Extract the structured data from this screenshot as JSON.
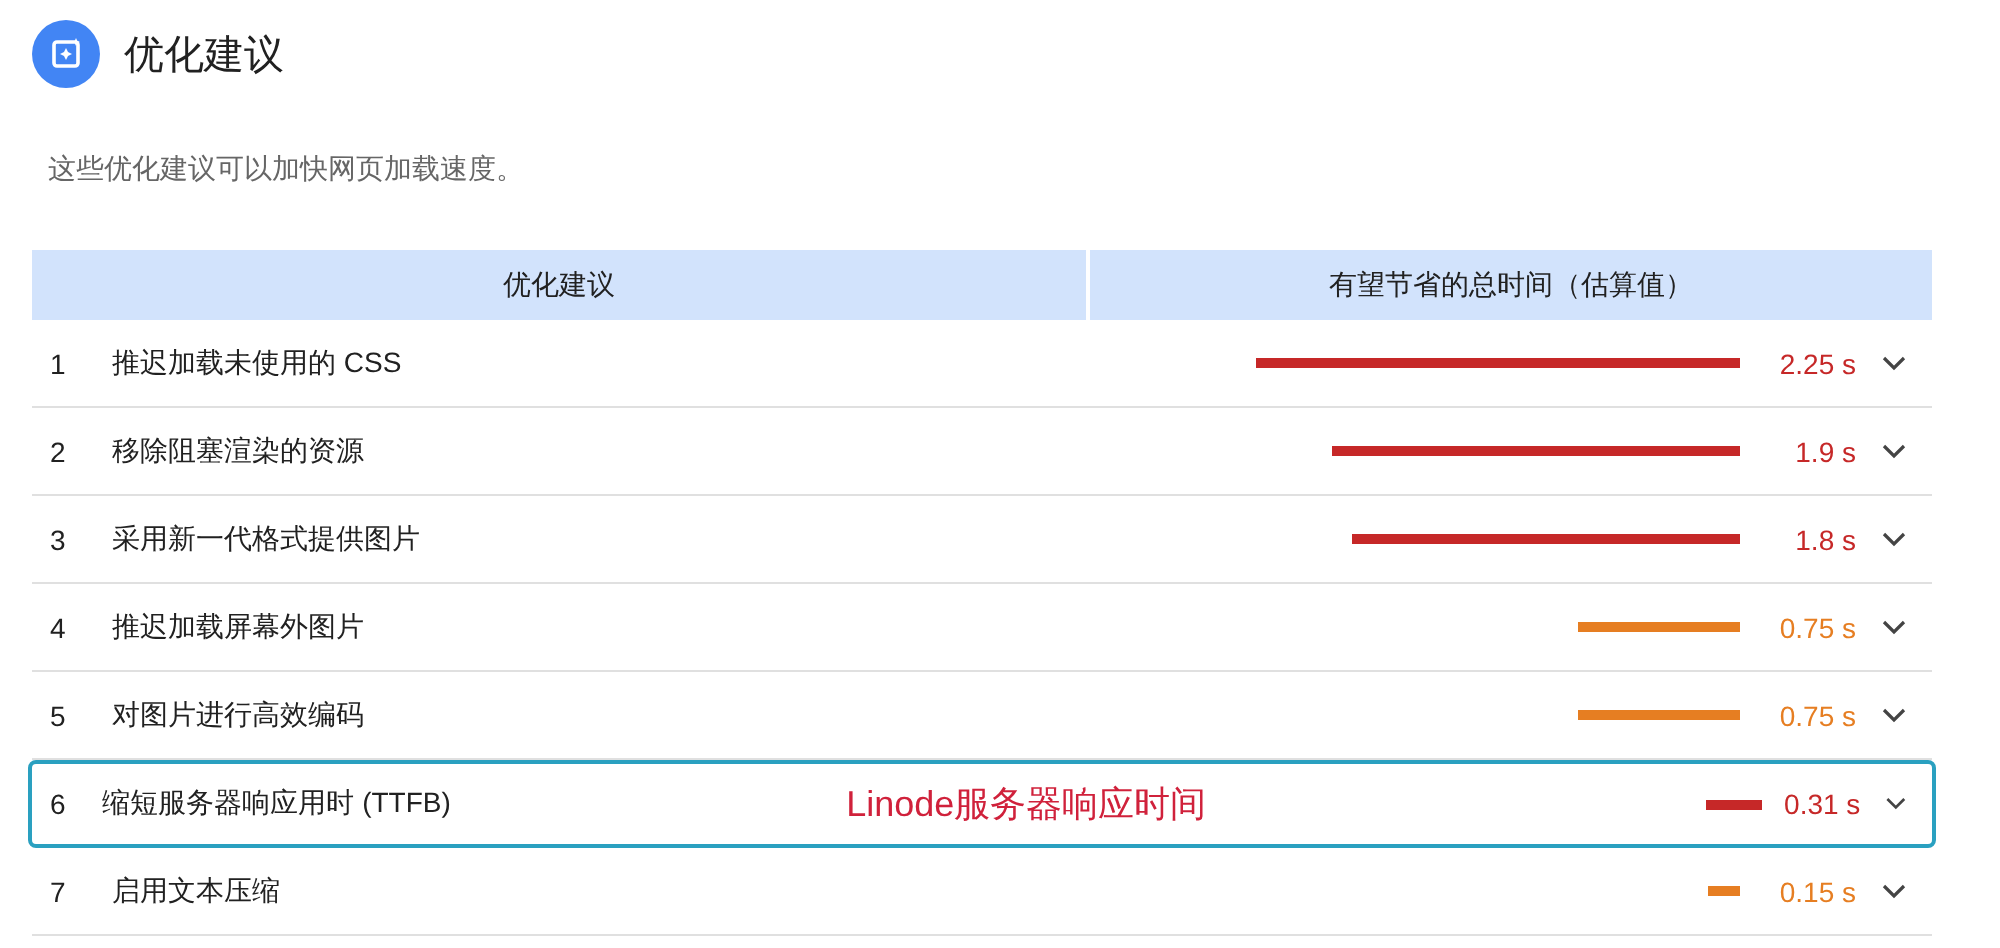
{
  "section": {
    "title": "优化建议",
    "description": "这些优化建议可以加快网页加载速度。"
  },
  "table": {
    "columns": [
      "优化建议",
      "有望节省的总时间（估算值）"
    ],
    "rows": [
      {
        "index": "1",
        "name": "推迟加载未使用的 CSS",
        "color": "#c62828",
        "savings": "2.25 s",
        "expanded": false,
        "highlighted": false
      },
      {
        "index": "2",
        "name": "移除阻塞渲染的资源",
        "color": "#c62828",
        "savings": "1.9 s",
        "expanded": false,
        "highlighted": false
      },
      {
        "index": "3",
        "name": "采用新一代格式提供图片",
        "color": "#c62828",
        "savings": "1.8 s",
        "expanded": false,
        "highlighted": false
      },
      {
        "index": "4",
        "name": "推迟加载屏幕外图片",
        "color": "#e67e22",
        "savings": "0.75 s",
        "expanded": false,
        "highlighted": false
      },
      {
        "index": "5",
        "name": "对图片进行高效编码",
        "color": "#e67e22",
        "savings": "0.75 s",
        "expanded": false,
        "highlighted": false
      },
      {
        "index": "6",
        "name": "缩短服务器响应用时 (TTFB)",
        "color": "#c62828",
        "savings": "0.31 s",
        "expanded": false,
        "highlighted": true,
        "annotation": "Linode服务器响应时间"
      },
      {
        "index": "7",
        "name": "启用文本压缩",
        "color": "#e67e22",
        "savings": "0.15 s",
        "expanded": false,
        "highlighted": false
      }
    ]
  }
}
